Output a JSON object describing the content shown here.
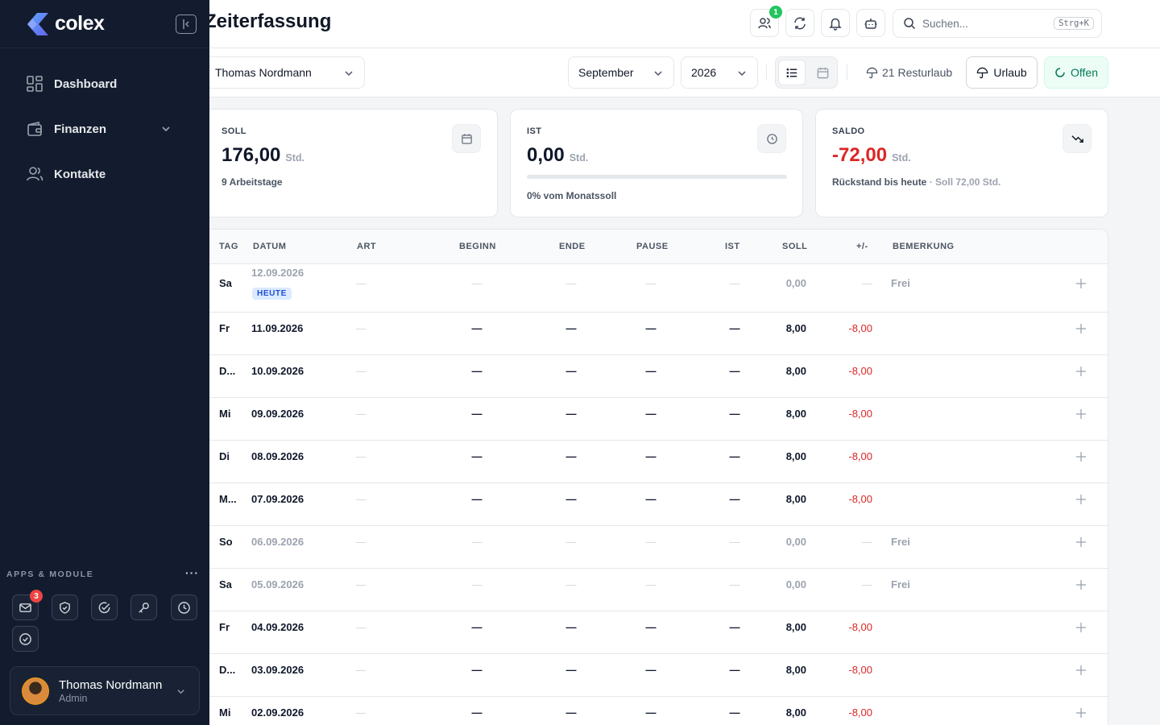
{
  "brand": {
    "name": "colex"
  },
  "sidebar": {
    "nav": [
      {
        "label": "Dashboard",
        "icon": "dashboard-grid-icon"
      },
      {
        "label": "Finanzen",
        "icon": "wallet-icon",
        "expandable": true
      },
      {
        "label": "Kontakte",
        "icon": "users-icon"
      }
    ],
    "apps_label": "APPS & MODULE",
    "apps_more": "···",
    "apps": [
      {
        "icon": "mail-icon",
        "badge": "3"
      },
      {
        "icon": "shield-check-icon"
      },
      {
        "icon": "check-circle-icon"
      },
      {
        "icon": "key-icon"
      },
      {
        "icon": "clock-icon"
      },
      {
        "icon": "check-circle-icon"
      }
    ],
    "user": {
      "name": "Thomas Nordmann",
      "role": "Admin"
    }
  },
  "header": {
    "title": "Zeiterfassung",
    "team_badge": "1",
    "search_placeholder": "Suchen...",
    "search_shortcut": "Strg+K"
  },
  "toolbar": {
    "employee": "Thomas Nordmann",
    "month": "September",
    "year": "2026",
    "rest_vacation": "21 Resturlaub",
    "vacation_button": "Urlaub",
    "status_button": "Offen"
  },
  "stats": {
    "soll": {
      "label": "SOLL",
      "value": "176,00",
      "unit": "Std.",
      "sub": "9 Arbeitstage"
    },
    "ist": {
      "label": "IST",
      "value": "0,00",
      "unit": "Std.",
      "sub": "0% vom Monatssoll",
      "progress": 0
    },
    "saldo": {
      "label": "SALDO",
      "value": "-72,00",
      "unit": "Std.",
      "sub": "Rückstand bis heute",
      "sub_muted": " · Soll 72,00 Std."
    }
  },
  "table": {
    "columns": [
      "TAG",
      "DATUM",
      "ART",
      "BEGINN",
      "ENDE",
      "PAUSE",
      "IST",
      "SOLL",
      "+/-",
      "BEMERKUNG"
    ],
    "today_badge": "HEUTE",
    "rows": [
      {
        "tag": "Sa",
        "datum": "12.09.2026",
        "art": "—",
        "beginn": "—",
        "ende": "—",
        "pause": "—",
        "ist": "—",
        "soll": "0,00",
        "diff": "—",
        "bemerkung": "Frei",
        "weekend": true,
        "today": true
      },
      {
        "tag": "Fr",
        "datum": "11.09.2026",
        "art": "—",
        "beginn": "—",
        "ende": "—",
        "pause": "—",
        "ist": "—",
        "soll": "8,00",
        "diff": "-8,00",
        "bemerkung": ""
      },
      {
        "tag": "D...",
        "datum": "10.09.2026",
        "art": "—",
        "beginn": "—",
        "ende": "—",
        "pause": "—",
        "ist": "—",
        "soll": "8,00",
        "diff": "-8,00",
        "bemerkung": ""
      },
      {
        "tag": "Mi",
        "datum": "09.09.2026",
        "art": "—",
        "beginn": "—",
        "ende": "—",
        "pause": "—",
        "ist": "—",
        "soll": "8,00",
        "diff": "-8,00",
        "bemerkung": ""
      },
      {
        "tag": "Di",
        "datum": "08.09.2026",
        "art": "—",
        "beginn": "—",
        "ende": "—",
        "pause": "—",
        "ist": "—",
        "soll": "8,00",
        "diff": "-8,00",
        "bemerkung": ""
      },
      {
        "tag": "M...",
        "datum": "07.09.2026",
        "art": "—",
        "beginn": "—",
        "ende": "—",
        "pause": "—",
        "ist": "—",
        "soll": "8,00",
        "diff": "-8,00",
        "bemerkung": ""
      },
      {
        "tag": "So",
        "datum": "06.09.2026",
        "art": "—",
        "beginn": "—",
        "ende": "—",
        "pause": "—",
        "ist": "—",
        "soll": "0,00",
        "diff": "—",
        "bemerkung": "Frei",
        "weekend": true
      },
      {
        "tag": "Sa",
        "datum": "05.09.2026",
        "art": "—",
        "beginn": "—",
        "ende": "—",
        "pause": "—",
        "ist": "—",
        "soll": "0,00",
        "diff": "—",
        "bemerkung": "Frei",
        "weekend": true
      },
      {
        "tag": "Fr",
        "datum": "04.09.2026",
        "art": "—",
        "beginn": "—",
        "ende": "—",
        "pause": "—",
        "ist": "—",
        "soll": "8,00",
        "diff": "-8,00",
        "bemerkung": ""
      },
      {
        "tag": "D...",
        "datum": "03.09.2026",
        "art": "—",
        "beginn": "—",
        "ende": "—",
        "pause": "—",
        "ist": "—",
        "soll": "8,00",
        "diff": "-8,00",
        "bemerkung": ""
      },
      {
        "tag": "Mi",
        "datum": "02.09.2026",
        "art": "—",
        "beginn": "—",
        "ende": "—",
        "pause": "—",
        "ist": "—",
        "soll": "8,00",
        "diff": "-8,00",
        "bemerkung": ""
      }
    ]
  },
  "colors": {
    "sidebar_bg": "#131c2e",
    "accent": "#22c55e",
    "negative": "#dc2626",
    "logo": "#6366f1"
  }
}
